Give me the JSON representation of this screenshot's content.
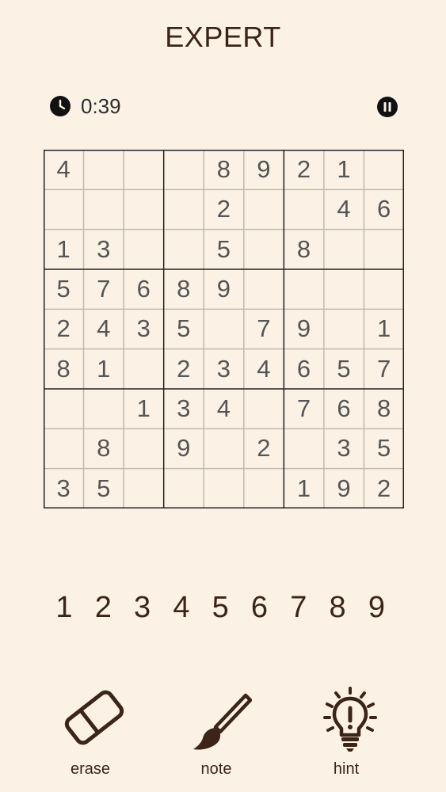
{
  "header": {
    "title": "EXPERT"
  },
  "status": {
    "timer": "0:39",
    "clock_icon": "clock-icon",
    "pause_icon": "pause-icon"
  },
  "board": {
    "rows": [
      [
        "4",
        "",
        "",
        "",
        "8",
        "9",
        "2",
        "1",
        ""
      ],
      [
        "",
        "",
        "",
        "",
        "2",
        "",
        "",
        "4",
        "6"
      ],
      [
        "1",
        "3",
        "",
        "",
        "5",
        "",
        "8",
        "",
        ""
      ],
      [
        "5",
        "7",
        "6",
        "8",
        "9",
        "",
        "",
        "",
        ""
      ],
      [
        "2",
        "4",
        "3",
        "5",
        "",
        "7",
        "9",
        "",
        "1"
      ],
      [
        "8",
        "1",
        "",
        "2",
        "3",
        "4",
        "6",
        "5",
        "7"
      ],
      [
        "",
        "",
        "1",
        "3",
        "4",
        "",
        "7",
        "6",
        "8"
      ],
      [
        "",
        "8",
        "",
        "9",
        "",
        "2",
        "",
        "3",
        "5"
      ],
      [
        "3",
        "5",
        "",
        "",
        "",
        "",
        "1",
        "9",
        "2"
      ]
    ]
  },
  "numpad": {
    "keys": [
      "1",
      "2",
      "3",
      "4",
      "5",
      "6",
      "7",
      "8",
      "9"
    ]
  },
  "tools": {
    "erase": {
      "label": "erase",
      "icon": "eraser-icon"
    },
    "note": {
      "label": "note",
      "icon": "brush-icon"
    },
    "hint": {
      "label": "hint",
      "icon": "lightbulb-icon"
    }
  },
  "colors": {
    "background": "#fbf2e5",
    "accent": "#3b2418",
    "digits": "#555555",
    "grid_thin": "#c2b9b0",
    "grid_thick": "#222222"
  }
}
